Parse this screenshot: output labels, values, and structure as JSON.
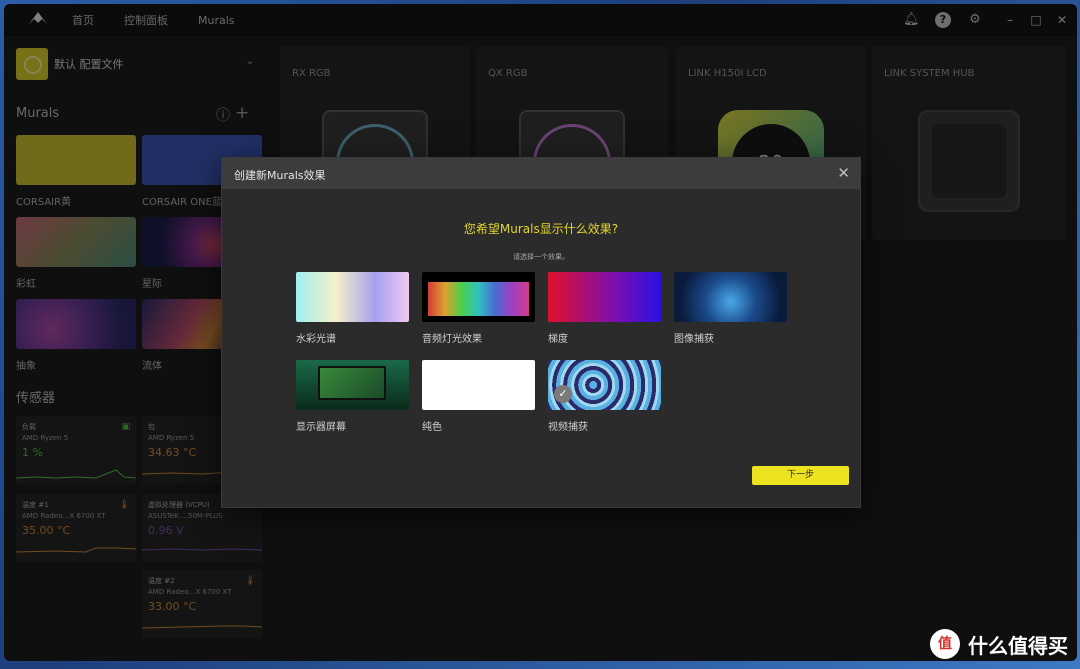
{
  "nav": {
    "home": "首页",
    "dashboard": "控制面板",
    "murals": "Murals"
  },
  "profile": {
    "label": "默认 配置文件"
  },
  "sidebar": {
    "murals_title": "Murals",
    "sensors_title": "传感器",
    "murals": [
      {
        "label": "CORSAIR黄"
      },
      {
        "label": "CORSAIR ONE蓝"
      },
      {
        "label": "彩虹"
      },
      {
        "label": "星际"
      },
      {
        "label": "抽象"
      },
      {
        "label": "流体"
      }
    ],
    "sensors": [
      {
        "name": "负载",
        "device": "AMD Ryzen 5",
        "value": "1",
        "unit": "%",
        "color": "#5bbf4a"
      },
      {
        "name": "包",
        "device": "AMD Ryzen 5",
        "value": "34.63",
        "unit": "°C",
        "color": "#d38a3c"
      },
      {
        "name": "温度 #1",
        "device": "AMD Radeo…X 6700 XT",
        "value": "35.00",
        "unit": "°C",
        "color": "#d38a3c"
      },
      {
        "name": "虚拟处理器 (VCPU)",
        "device": "ASUSTeK …50M-PLUS",
        "value": "0.96",
        "unit": "V",
        "color": "#7f4fb0"
      },
      {
        "name": "温度 #2",
        "device": "AMD Radeo…X 6700 XT",
        "value": "33.00",
        "unit": "°C",
        "color": "#d38a3c"
      }
    ]
  },
  "devices": [
    {
      "name": "RX RGB"
    },
    {
      "name": "QX RGB"
    },
    {
      "name": "LINK H150I LCD",
      "lcd_value": "20"
    },
    {
      "name": "LINK SYSTEM HUB"
    }
  ],
  "modal": {
    "title": "创建新Murals效果",
    "question": "您希望Murals显示什么效果?",
    "subtitle": "请选择一个效果。",
    "options": [
      {
        "label": "水彩光谱"
      },
      {
        "label": "音频灯光效果"
      },
      {
        "label": "梯度"
      },
      {
        "label": "图像捕获"
      },
      {
        "label": "显示器屏幕"
      },
      {
        "label": "纯色"
      },
      {
        "label": "视频捕获",
        "selected": true
      }
    ],
    "next_label": "下一步"
  },
  "watermark": {
    "text": "什么值得买",
    "badge": "值"
  },
  "colors": {
    "accent": "#ede31f",
    "question": "#e3d62c"
  }
}
